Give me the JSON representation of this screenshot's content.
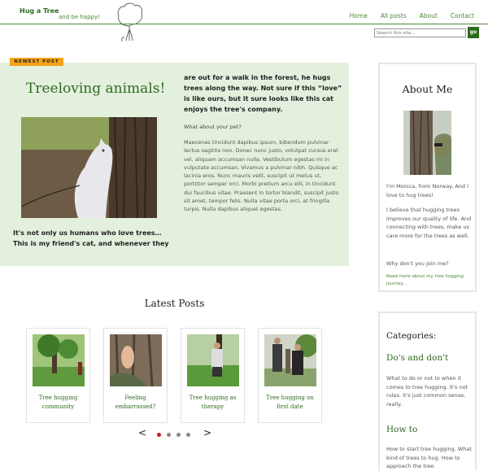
{
  "header": {
    "brand": "Hug a Tree",
    "tagline": "and be happy!",
    "nav": [
      "Home",
      "All posts",
      "About",
      "Contact"
    ]
  },
  "search": {
    "placeholder": "Search this site...",
    "button": "go"
  },
  "featured": {
    "badge": "NEWEST POST",
    "title": "Treeloving animals!",
    "lead_left": "It's not only us humans who love trees… This is my friend's cat, and whenever they",
    "lead_right": "are out for a walk in the forest, he hugs trees along the way. Not sure if this “love” is like ours, but it sure looks like this cat enjoys the tree's company.",
    "question": "What about your pet?",
    "body": "Maecenas tincidunt dapibus ipsum, bibendum pulvinar lectus sagittis non. Donec nunc justo, volutpat cursus erat vel, aliquam accumsan nulla. Vestibulum egestas mi in vulputate accumsan. Vivamus a pulvinar nibh. Quisque ac lacinia eros. Nunc mauris velit, suscipit ut metus ut, porttitor semper orci. Morbi pretium arcu elit, in tincidunt dui faucibus vitae. Praesent in tortor blandit, suscipit justo sit amet, tempor felis. Nulla vitae porta orci, at fringilla turpis. Nulla dapibus aliquet egestas."
  },
  "about": {
    "title": "About Me",
    "p1": "I'm Monica, from Norway. And I love to hug trees!",
    "p2": "I believe that hugging trees improves our quality of life. And connecting with trees, make us care more for the trees as well.",
    "p3": "Why don't you join me?",
    "link": "Read more about my tree hugging journey..."
  },
  "categories": {
    "title": "Categories:",
    "items": [
      {
        "name": "Do's and don't",
        "desc": "What to do or not to when it comes to tree hugging. It's not rules. It's just common sense, really."
      },
      {
        "name": "How to",
        "desc": "How to start tree hugging. What kind of trees to hug. How to approach the tree."
      }
    ]
  },
  "latest": {
    "title": "Latest Posts",
    "posts": [
      {
        "title": "Tree hugging community"
      },
      {
        "title": "Feeling embarrassed?"
      },
      {
        "title": "Tree hugging as therapy"
      },
      {
        "title": "Tree hugging on first date"
      }
    ],
    "prev": "<",
    "next": ">",
    "active_page": 1,
    "page_count": 4
  },
  "colors": {
    "accent": "#2e6b1e",
    "badge": "#f4a316",
    "featured_bg": "#e4f0de",
    "active_dot": "#d0141b"
  }
}
